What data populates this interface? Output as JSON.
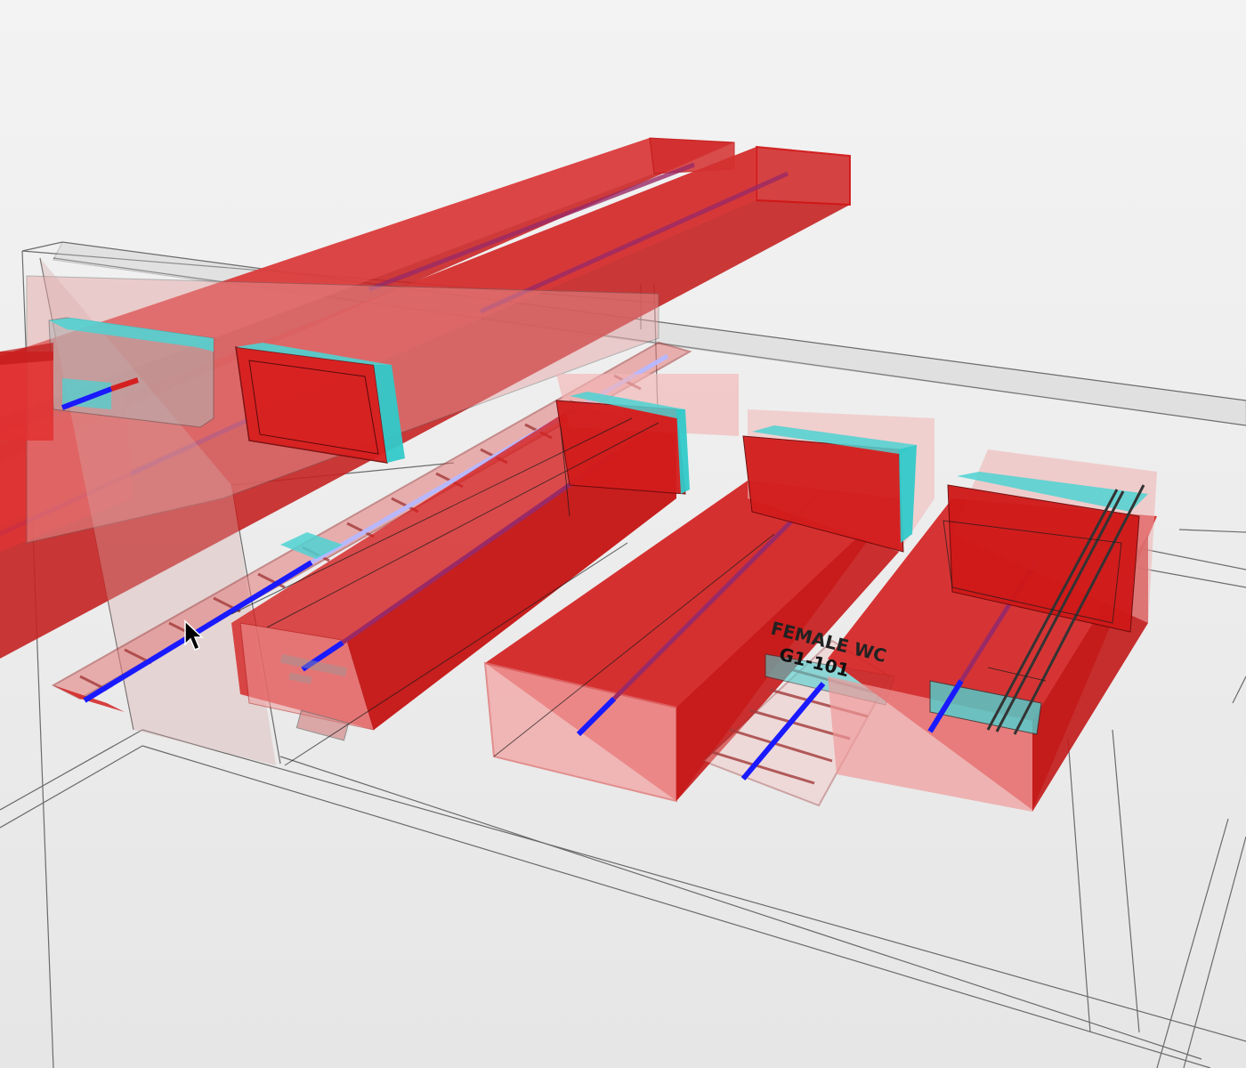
{
  "viewport": {
    "background_top": "#f2f2f2",
    "background_bottom": "#e4e4e4"
  },
  "colors": {
    "duct_fill": "#d42020",
    "duct_light": "#ee8a8a",
    "duct_edge": "#c01010",
    "insulation": "#49d4d4",
    "pipe_blue": "#1a1aff",
    "pipe_purple": "#9a2a66",
    "tray_edge": "#a33a3a",
    "wire": "#333333"
  },
  "room_tag": {
    "name": "FEMALE WC",
    "number": "G1-101"
  },
  "cursor": {
    "icon": "mouse-pointer-icon"
  }
}
